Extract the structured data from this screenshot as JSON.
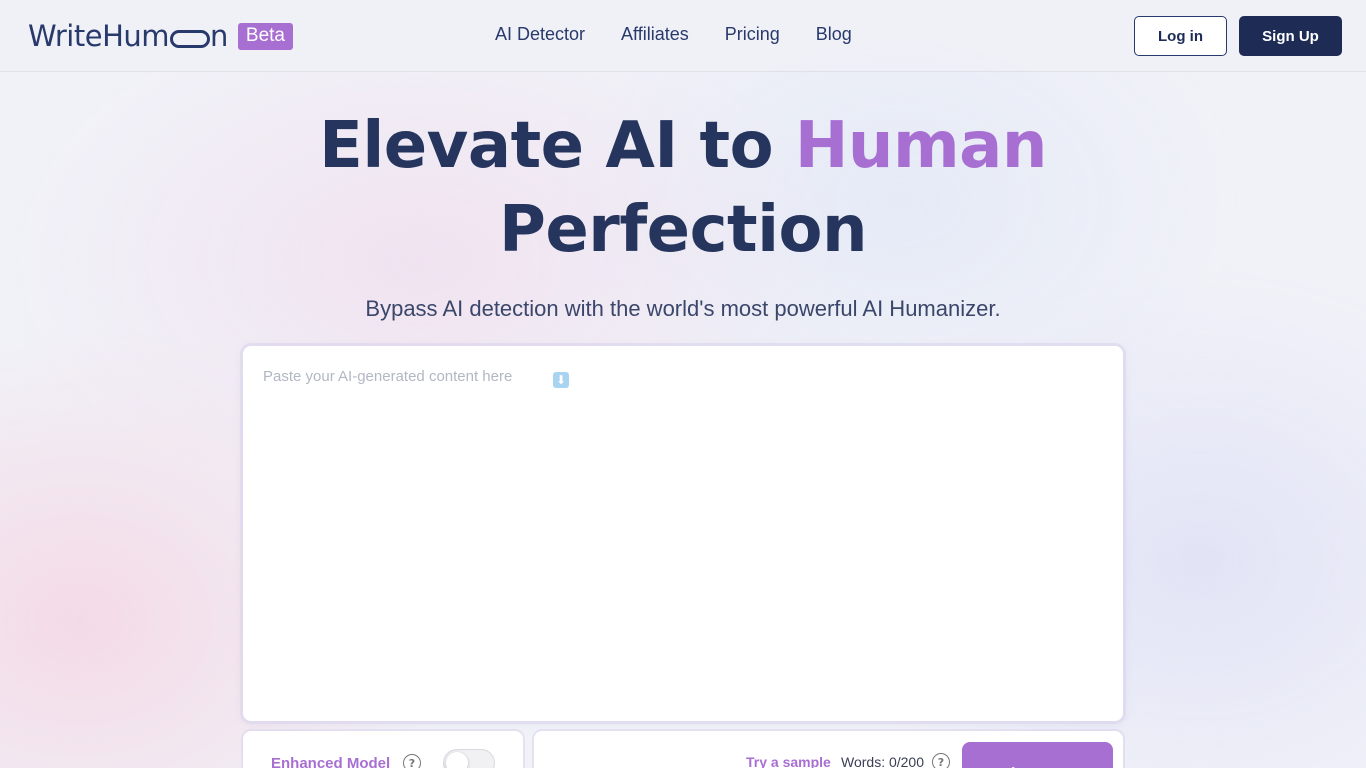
{
  "header": {
    "logo_text": "WriteHum",
    "logo_suffix": "n",
    "beta_badge": "Beta",
    "nav": [
      {
        "label": "AI Detector"
      },
      {
        "label": "Affiliates"
      },
      {
        "label": "Pricing"
      },
      {
        "label": "Blog"
      }
    ],
    "login_label": "Log in",
    "signup_label": "Sign Up"
  },
  "hero": {
    "title_part1": "Elevate AI to ",
    "title_accent": "Human",
    "title_part2": "Perfection",
    "subtitle": "Bypass AI detection with the world's most powerful AI Humanizer."
  },
  "editor": {
    "placeholder": "Paste your AI-generated content here",
    "placeholder_icon": "down-arrow-icon",
    "value": ""
  },
  "controls": {
    "model_label": "Enhanced Model",
    "model_enabled": false,
    "try_sample_label": "Try a sample",
    "word_count": "Words: 0/200",
    "submit_label": "Write Human"
  },
  "colors": {
    "brand_navy": "#1d2b55",
    "accent_purple": "#a86fd3"
  }
}
